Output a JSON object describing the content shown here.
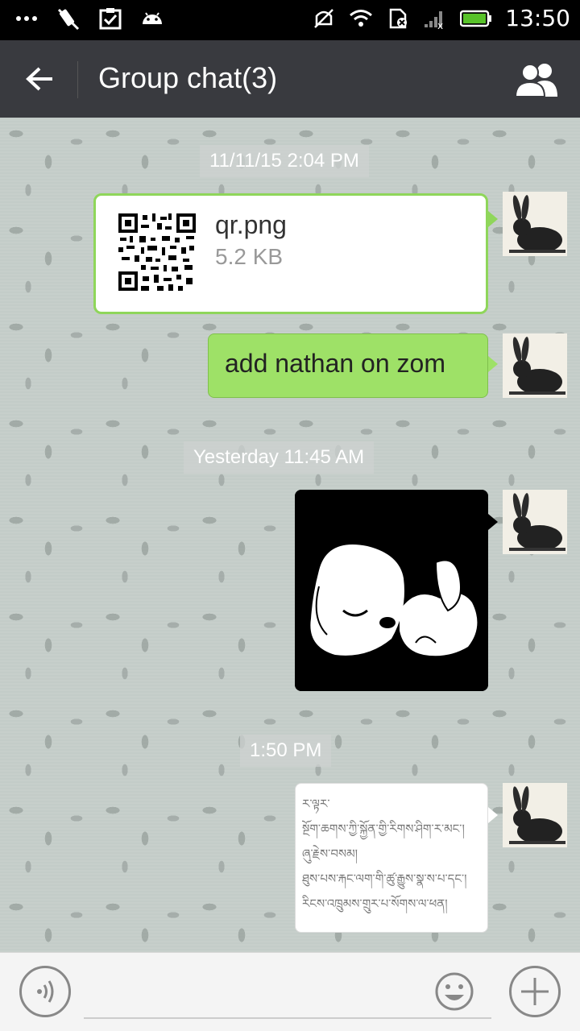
{
  "status_bar": {
    "time": "13:50",
    "icons": [
      "more-dots-icon",
      "no-pen-icon",
      "clipboard-check-icon",
      "android-icon",
      "mute-icon",
      "wifi-icon",
      "sim-icon",
      "signal-icon",
      "battery-icon"
    ]
  },
  "header": {
    "title": "Group chat(3)",
    "back_icon": "back-arrow-icon",
    "members_icon": "group-members-icon"
  },
  "messages": [
    {
      "type": "timestamp",
      "text": "11/11/15 2:04 PM"
    },
    {
      "type": "file",
      "name": "qr.png",
      "size": "5.2 KB",
      "icon": "qr-code-icon"
    },
    {
      "type": "text",
      "text": "add nathan on zom"
    },
    {
      "type": "timestamp",
      "text": "Yesterday 11:45 AM"
    },
    {
      "type": "image",
      "description_icon": "sleeping-puppy-sticker"
    },
    {
      "type": "timestamp",
      "text": "1:50 PM"
    },
    {
      "type": "tibetan",
      "lines": [
        "ར་ལྟར་",
        "སྔོག་ཆགས་ཀྱི་སྐྱོན་གྱི་རིགས་ཤིག་ར་མང་།",
        "ཞུ་རྗེས་བསམ།",
        "ཐུས་པས་རྐང་ལག་གི་ཚུ་རྒྱུས་སྣ་ས་པ་དང་།",
        "རིངས་འཁྲུམས་གྲུར་པ་སོགས་ལ་ཕན།"
      ]
    }
  ],
  "input_bar": {
    "voice_icon": "voice-icon",
    "emoji_icon": "emoji-icon",
    "plus_icon": "plus-icon"
  },
  "colors": {
    "header_bg": "#393a3f",
    "sent_bubble": "#9ee167",
    "chat_bg": "#c3ccc8"
  }
}
